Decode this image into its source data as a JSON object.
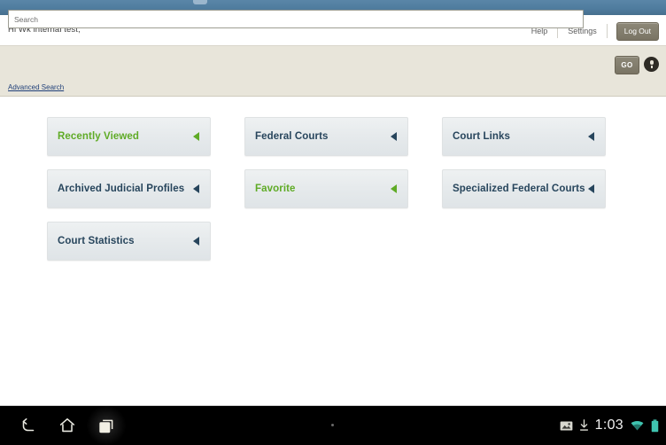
{
  "window": {
    "top_bar_color": "#4f7c9e"
  },
  "header": {
    "greeting": "Hi Wk internal test,",
    "help_label": "Help",
    "settings_label": "Settings",
    "logout_label": "Log Out"
  },
  "search": {
    "placeholder": "Search",
    "value": "",
    "go_label": "GO",
    "mic_icon": "microphone-icon",
    "advanced_search_label": "Advanced Search"
  },
  "tiles": [
    [
      {
        "label": "Recently Viewed",
        "color": "#5fab26",
        "style": "green"
      },
      {
        "label": "Federal Courts",
        "color": "#27455c",
        "style": "dark"
      },
      {
        "label": "Court Links",
        "color": "#27455c",
        "style": "dark"
      }
    ],
    [
      {
        "label": "Archived Judicial Profiles",
        "color": "#27455c",
        "style": "dark"
      },
      {
        "label": "Favorite",
        "color": "#5fab26",
        "style": "green"
      },
      {
        "label": "Specialized Federal Courts",
        "color": "#27455c",
        "style": "dark"
      }
    ],
    [
      {
        "label": "Court Statistics",
        "color": "#27455c",
        "style": "dark"
      }
    ]
  ],
  "navbar": {
    "back_icon": "back-arrow-icon",
    "home_icon": "home-icon",
    "recents_icon": "recent-apps-icon",
    "screenshot_icon": "screenshot-icon",
    "download_icon": "download-icon",
    "clock": "1:03",
    "wifi_icon": "wifi-icon",
    "battery_icon": "battery-icon"
  }
}
